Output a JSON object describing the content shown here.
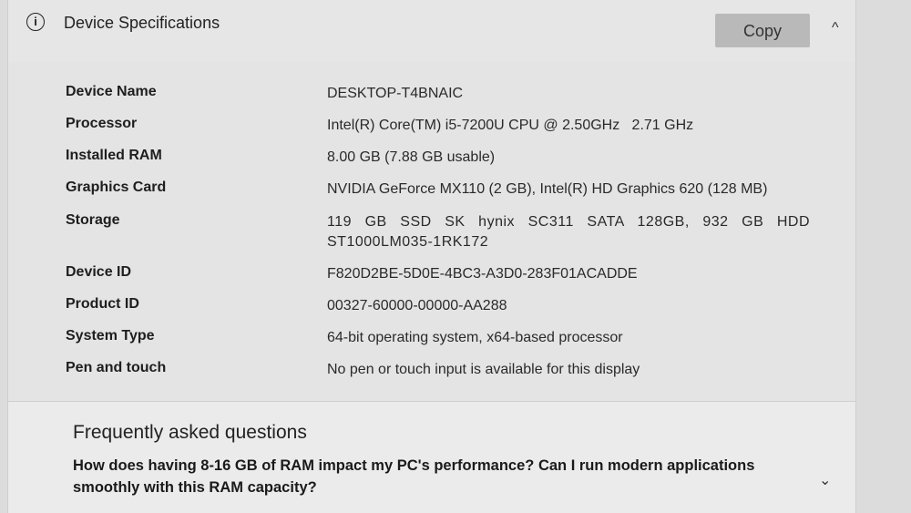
{
  "header": {
    "info_icon_glyph": "i",
    "title": "Device Specifications",
    "copy_label": "Copy",
    "collapse_glyph": "^"
  },
  "specs": [
    {
      "label": "Device Name",
      "value": "DESKTOP-T4BNAIC"
    },
    {
      "label": "Processor",
      "value": "Intel(R) Core(TM) i5-7200U CPU @ 2.50GHz   2.71 GHz"
    },
    {
      "label": "Installed RAM",
      "value": "8.00 GB (7.88 GB usable)"
    },
    {
      "label": "Graphics Card",
      "value": "NVIDIA GeForce MX110 (2 GB), Intel(R) HD Graphics 620 (128 MB)"
    },
    {
      "label": "Storage",
      "value": "119 GB SSD SK hynix SC311 SATA 128GB, 932 GB HDD ST1000LM035-1RK172"
    },
    {
      "label": "Device ID",
      "value": "F820D2BE-5D0E-4BC3-A3D0-283F01ACADDE"
    },
    {
      "label": "Product ID",
      "value": "00327-60000-00000-AA288"
    },
    {
      "label": "System Type",
      "value": "64-bit operating system, x64-based processor"
    },
    {
      "label": "Pen and touch",
      "value": "No pen or touch input is available for this display"
    }
  ],
  "faq": {
    "title": "Frequently asked questions",
    "question": "How does having 8-16 GB of RAM impact my PC's performance? Can I run modern applications smoothly with this RAM capacity?",
    "expand_glyph": "⌄"
  }
}
